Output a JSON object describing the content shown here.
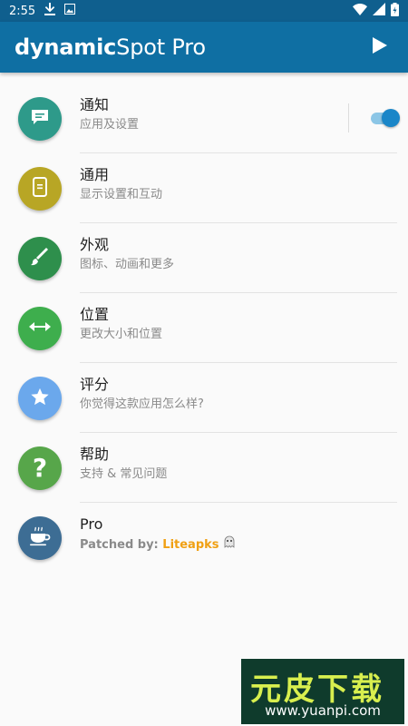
{
  "status_bar": {
    "time": "2:55"
  },
  "app_bar": {
    "title_bold": "dynamic",
    "title_light": "Spot Pro"
  },
  "list": {
    "items": [
      {
        "title": "通知",
        "subtitle": "应用及设置",
        "color": "#2e9a8a",
        "icon": "message-icon",
        "toggle_on": true
      },
      {
        "title": "通用",
        "subtitle": "显示设置和互动",
        "color": "#b8a625",
        "icon": "phone-icon"
      },
      {
        "title": "外观",
        "subtitle": "图标、动画和更多",
        "color": "#2e8f4c",
        "icon": "brush-icon"
      },
      {
        "title": "位置",
        "subtitle": "更改大小和位置",
        "color": "#3eae4d",
        "icon": "arrows-horizontal-icon"
      },
      {
        "title": "评分",
        "subtitle": "你觉得这款应用怎么样?",
        "color": "#6ba8ec",
        "icon": "star-icon"
      },
      {
        "title": "帮助",
        "subtitle": "支持 & 常见问题",
        "color": "#57a64a",
        "icon": "question-icon"
      },
      {
        "title": "Pro",
        "subtitle_prefix": "Patched by: ",
        "subtitle_brand": "Liteapks",
        "color": "#3d6d94",
        "icon": "coffee-cup-icon"
      }
    ]
  },
  "watermark": {
    "cn": "元皮下载",
    "url": "www.yuanpi.com"
  }
}
